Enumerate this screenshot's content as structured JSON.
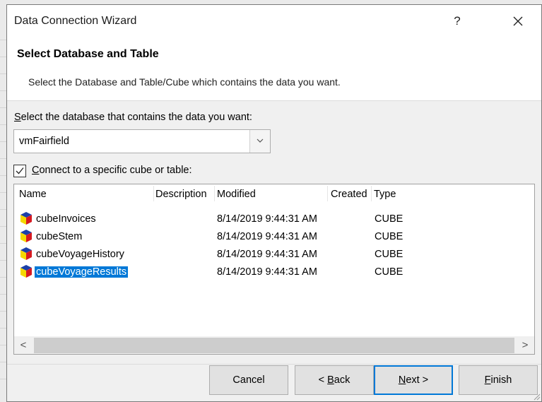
{
  "window": {
    "title": "Data Connection Wizard",
    "help_glyph": "?",
    "close_glyph": "✕"
  },
  "header": {
    "title": "Select Database and Table",
    "subtitle": "Select the Database and Table/Cube which contains the data you want."
  },
  "database": {
    "label_mnemonic": "S",
    "label_rest": "elect the database that contains the data you want:",
    "selected": "vmFairfield"
  },
  "connect_checkbox": {
    "checked": true,
    "label_mnemonic": "C",
    "label_rest": "onnect to a specific cube or table:"
  },
  "table": {
    "columns": [
      "Name",
      "Description",
      "Modified",
      "Created",
      "Type"
    ],
    "rows": [
      {
        "name": "cubeInvoices",
        "description": "",
        "modified": "8/14/2019 9:44:31 AM",
        "created": "",
        "type": "CUBE",
        "selected": false
      },
      {
        "name": "cubeStem",
        "description": "",
        "modified": "8/14/2019 9:44:31 AM",
        "created": "",
        "type": "CUBE",
        "selected": false
      },
      {
        "name": "cubeVoyageHistory",
        "description": "",
        "modified": "8/14/2019 9:44:31 AM",
        "created": "",
        "type": "CUBE",
        "selected": false
      },
      {
        "name": "cubeVoyageResults",
        "description": "",
        "modified": "8/14/2019 9:44:31 AM",
        "created": "",
        "type": "CUBE",
        "selected": true
      }
    ],
    "scroll_left": "<",
    "scroll_right": ">"
  },
  "buttons": {
    "cancel": "Cancel",
    "back_prefix": "< ",
    "back_mnemonic": "B",
    "back_rest": "ack",
    "next_mnemonic": "N",
    "next_rest": "ext >",
    "finish_mnemonic": "F",
    "finish_rest": "inish"
  },
  "colors": {
    "selection": "#0078d7",
    "dialog_bg": "#f0f0f0",
    "cube_icon": [
      "#1b3fa8",
      "#f5d800",
      "#d71920"
    ]
  },
  "icons": {
    "cube": "cube-icon",
    "dropdown": "chevron-down-icon",
    "checkbox": "checkmark-icon"
  }
}
